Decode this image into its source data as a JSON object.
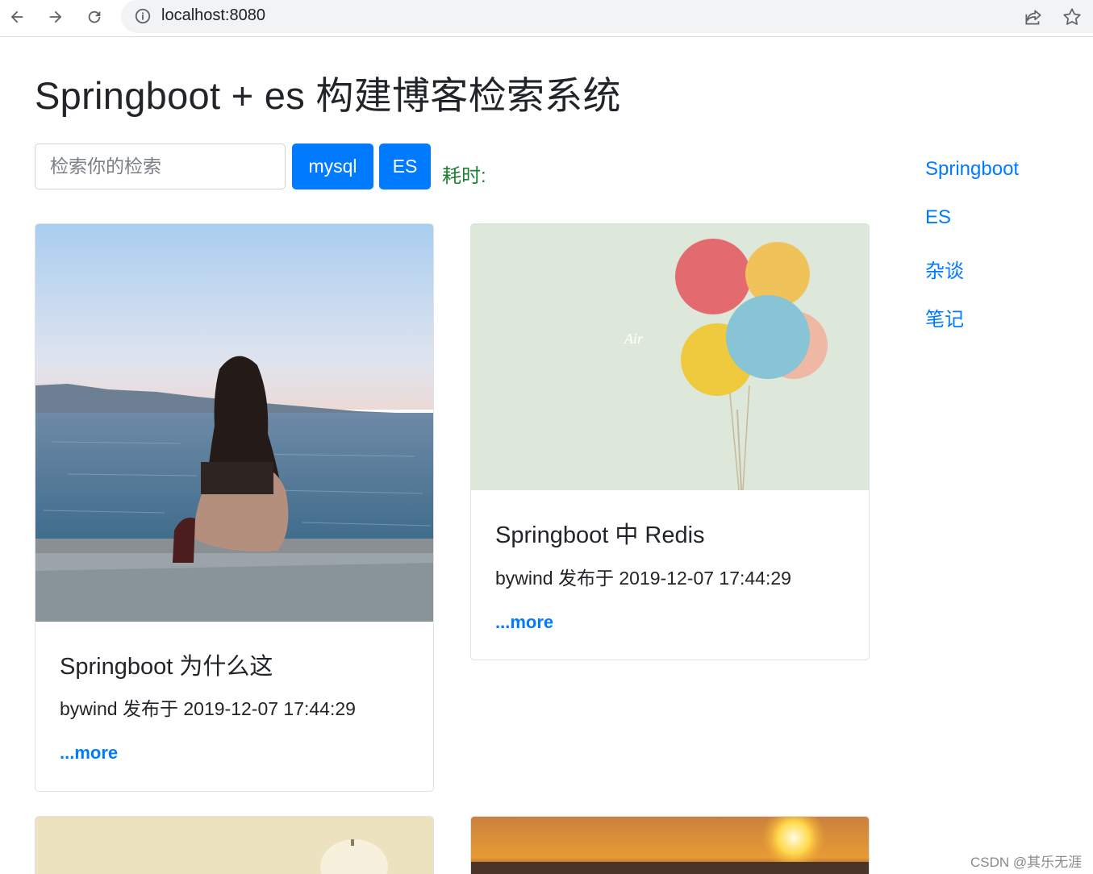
{
  "browser": {
    "url": "localhost:8080",
    "icons": [
      "back-arrow-icon",
      "forward-arrow-icon",
      "reload-icon",
      "info-icon",
      "share-icon",
      "star-icon"
    ]
  },
  "page": {
    "title": "Springboot + es 构建博客检索系统"
  },
  "search": {
    "placeholder": "检索你的检索",
    "value": "",
    "mysql_label": "mysql",
    "es_label": "ES",
    "elapsed_label": "耗时:"
  },
  "sidebar": {
    "items": [
      {
        "label": "Springboot"
      },
      {
        "label": "ES"
      },
      {
        "label": "杂谈"
      },
      {
        "label": "笔记"
      }
    ]
  },
  "posts": [
    {
      "title": "Springboot 为什么这",
      "meta": "bywind 发布于 2019-12-07 17:44:29",
      "more": "...more"
    },
    {
      "title": "Springboot 中 Redis",
      "meta": "bywind 发布于 2019-12-07 17:44:29",
      "more": "...more"
    }
  ],
  "watermark": "CSDN @其乐无涯",
  "colors": {
    "primary": "#007bff",
    "success_text": "#1e7e34",
    "text": "#212529"
  }
}
